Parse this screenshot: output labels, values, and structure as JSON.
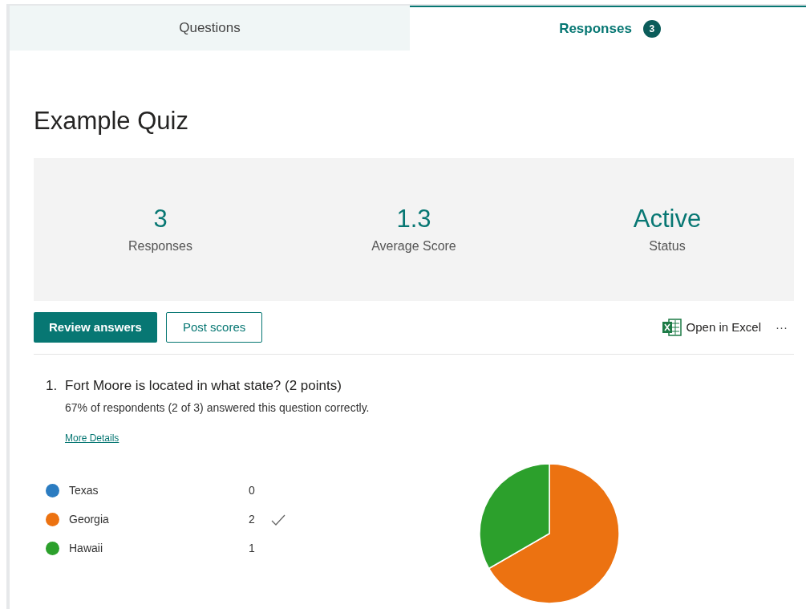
{
  "tabs": [
    {
      "label": "Questions",
      "selected": false
    },
    {
      "label": "Responses",
      "selected": true,
      "badge": "3"
    }
  ],
  "title": "Example Quiz",
  "stats": [
    {
      "value": "3",
      "label": "Responses"
    },
    {
      "value": "1.3",
      "label": "Average Score"
    },
    {
      "value": "Active",
      "label": "Status"
    }
  ],
  "actions": {
    "primary": "Review answers",
    "secondary": "Post scores",
    "excel": "Open in Excel",
    "more": "···"
  },
  "question": {
    "number": "1.",
    "text": "Fort Moore is located in what state? (2 points)",
    "summary": "67% of respondents (2 of 3) answered this question correctly.",
    "link": "More Details",
    "options": [
      {
        "label": "Texas",
        "count": "0",
        "correct": false,
        "color": "#2b7cc1"
      },
      {
        "label": "Georgia",
        "count": "2",
        "correct": true,
        "color": "#ec7211"
      },
      {
        "label": "Hawaii",
        "count": "1",
        "correct": false,
        "color": "#2ca02c"
      }
    ]
  }
}
